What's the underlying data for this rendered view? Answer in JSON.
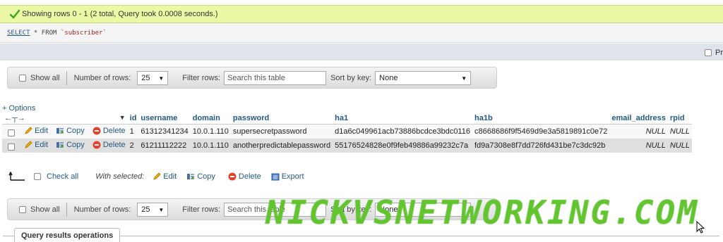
{
  "success": {
    "message": "Showing rows 0 - 1 (2 total, Query took 0.0008 seconds.)"
  },
  "sql": {
    "keyword": "SELECT",
    "rest": " * FROM ",
    "table": "`subscriber`"
  },
  "profiling": {
    "label": "Pr"
  },
  "nav": {
    "show_all": "Show all",
    "rows_label": "Number of rows:",
    "rows_value": "25",
    "filter_label": "Filter rows:",
    "filter_placeholder": "Search this table",
    "sort_label": "Sort by key:",
    "sort_value": "None"
  },
  "options": "+ Options",
  "table": {
    "columns": [
      "id",
      "username",
      "domain",
      "password",
      "ha1",
      "ha1b",
      "email_address",
      "rpid"
    ],
    "actions": {
      "edit": "Edit",
      "copy": "Copy",
      "delete": "Delete"
    },
    "rows": [
      {
        "id": "1",
        "username": "61312341234",
        "domain": "10.0.1.110",
        "password": "supersecretpassword",
        "ha1": "d1a6c049961acb73886bcdce3bdc0116",
        "ha1b": "c8668686f9f5469d9e3a5819891c0e72",
        "email_address": "NULL",
        "rpid": "NULL"
      },
      {
        "id": "2",
        "username": "61211112222",
        "domain": "10.0.1.110",
        "password": "anotherpredictablepassword",
        "ha1": "55176524828e0f9feb49886a99232c7a",
        "ha1b": "fd9a7308e8f7dd726fd431be7c3dc92b",
        "email_address": "NULL",
        "rpid": "NULL"
      }
    ]
  },
  "bulk": {
    "check_all": "Check all",
    "with_selected": "With selected:",
    "edit": "Edit",
    "copy": "Copy",
    "delete": "Delete",
    "export": "Export"
  },
  "query_ops": "Query results operations",
  "watermark": "NICKVSNETWORKING.COM",
  "colors": {
    "link": "#235a81",
    "success_bg": "#ebf8a4",
    "watermark": "#78dc3c"
  }
}
